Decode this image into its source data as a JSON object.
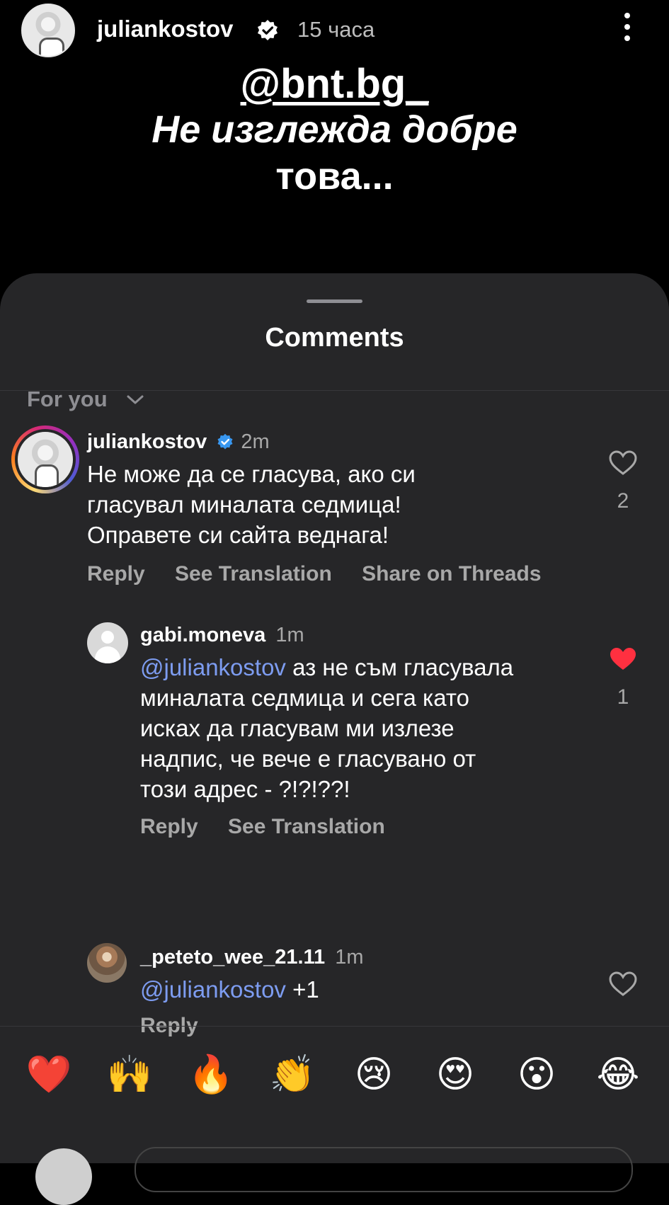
{
  "story": {
    "username": "juliankostov",
    "time": "15 часа",
    "mention": "@bnt.bg_",
    "caption_line1": "Не изглежда добре",
    "caption_line2": "това..."
  },
  "sheet": {
    "title": "Comments",
    "filter": "For you"
  },
  "comments": [
    {
      "username": "juliankostov",
      "time": "2m",
      "verified": true,
      "text_lines": [
        "Не може да се гласува, ако си",
        "гласувал миналата седмица!",
        "Оправете си сайта веднага!"
      ],
      "actions": [
        "Reply",
        "See Translation",
        "Share on Threads"
      ],
      "likes": "2",
      "liked": false
    },
    {
      "username": "gabi.moneva",
      "time": "1m",
      "mention": "@juliankostov",
      "text_lines": [
        " аз не съм гласувала",
        "миналата седмица и сега като",
        "исках да гласувам ми излезе",
        "надпис, че вече е гласувано от",
        "този адрес - ?!?!??!"
      ],
      "actions": [
        "Reply",
        "See Translation"
      ],
      "likes": "1",
      "liked": true
    },
    {
      "username": "_peteto_wee_21.11",
      "time": "1m",
      "mention": "@juliankostov",
      "text": " +1",
      "actions": [
        "Reply"
      ],
      "liked": false
    }
  ],
  "emoji_bar": [
    "❤️",
    "🙌",
    "🔥",
    "👏",
    "😢",
    "😍",
    "😮",
    "😂"
  ],
  "colors": {
    "background": "#000000",
    "sheet": "#262628",
    "secondary_text": "#a8a8a8",
    "mention": "#7d9cf0",
    "like_red": "#ff3040",
    "verified_blue": "#3897f0"
  }
}
